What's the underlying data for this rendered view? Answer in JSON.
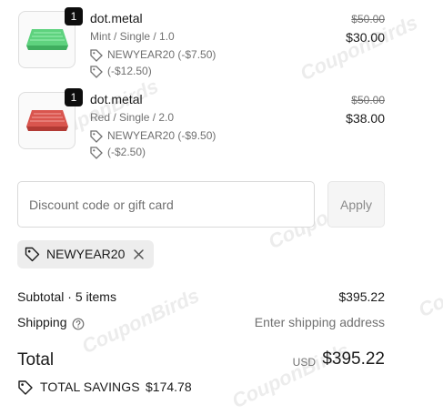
{
  "items": [
    {
      "quantity": "1",
      "name": "dot.metal",
      "variant": "Mint / Single / 1.0",
      "discounts": [
        "NEWYEAR20 (-$7.50)",
        "(-$12.50)"
      ],
      "original_price": "$50.00",
      "price": "$30.00",
      "color": "#5ed27e"
    },
    {
      "quantity": "1",
      "name": "dot.metal",
      "variant": "Red / Single / 2.0",
      "discounts": [
        "NEWYEAR20 (-$9.50)",
        "(-$2.50)"
      ],
      "original_price": "$50.00",
      "price": "$38.00",
      "color": "#d9554e"
    }
  ],
  "discount": {
    "placeholder": "Discount code or gift card",
    "apply_label": "Apply",
    "applied_code": "NEWYEAR20"
  },
  "summary": {
    "subtotal_label": "Subtotal · 5 items",
    "subtotal_value": "$395.22",
    "shipping_label": "Shipping",
    "shipping_value": "Enter shipping address",
    "total_label": "Total",
    "currency": "USD",
    "total_value": "$395.22",
    "savings_label": "TOTAL SAVINGS",
    "savings_value": "$174.78"
  },
  "watermark_text": "CouponBirds"
}
